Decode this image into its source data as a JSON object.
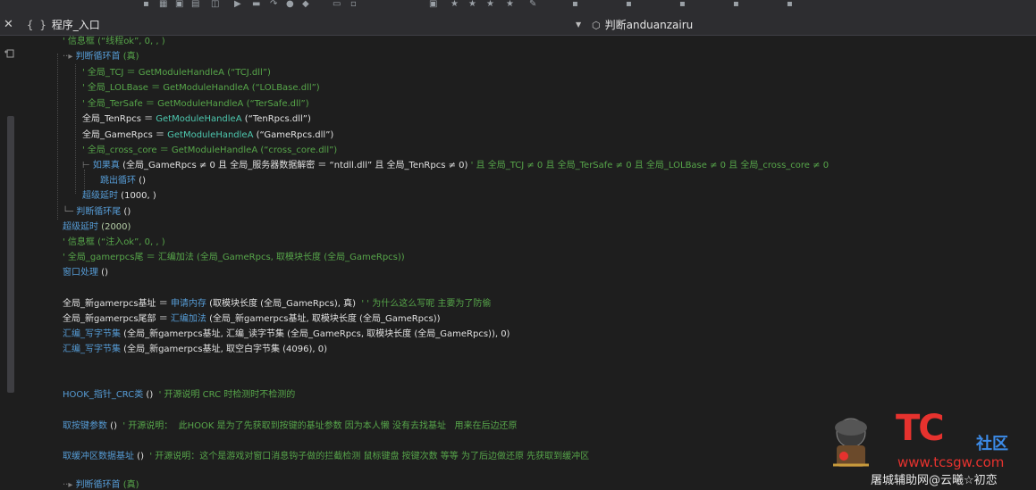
{
  "tabs": {
    "member_label": "程序_入口",
    "procedure_label": "判断anduanzairu"
  },
  "code": {
    "l1": "' 信息框 (“线程ok”, 0, , )",
    "l2a": "判断循环首",
    "l2b": " (真)",
    "l3": "' 全局_TCJ ＝ GetModuleHandleA (“TCJ.dll”)",
    "l4": "' 全局_LOLBase ＝ GetModuleHandleA (“LOLBase.dll”)",
    "l5": "' 全局_TerSafe ＝ GetModuleHandleA (“TerSafe.dll”)",
    "l6a": "全局_TenRpcs ＝ ",
    "l6b": "GetModuleHandleA",
    "l6c": " (“TenRpcs.dll”)",
    "l7a": "全局_GameRpcs ＝ ",
    "l7b": "GetModuleHandleA",
    "l7c": " (“GameRpcs.dll”)",
    "l8": "' 全局_cross_core ＝ GetModuleHandleA (“cross_core.dll”)",
    "l9a": "如果真",
    "l9b": " (全局_GameRpcs ≠ 0 且 全局_服务器数据解密 ＝ “ntdll.dll” 且 全局_TenRpcs ≠ 0)",
    "l9c": " ' 且 全局_TCJ ≠ 0 且 全局_TerSafe ≠ 0 且 全局_LOLBase ≠ 0 且 全局_cross_core ≠ 0",
    "l10a": "跳出循环",
    "l10b": " ()",
    "l11a": "超级延时",
    "l11b": " (1000, )",
    "l12a": "判断循环尾",
    "l12b": " ()",
    "l13a": "超级延时",
    "l13b": " (2000)",
    "l14": "' 信息框 (“注入ok”, 0, , )",
    "l15": "' 全局_gamerpcs尾 ＝ 汇编加法 (全局_GameRpcs, 取模块长度 (全局_GameRpcs))",
    "l16a": "窗口处理",
    "l16b": " ()",
    "l17a": "全局_新gamerpcs基址 ＝ ",
    "l17b": "申请内存",
    "l17c": " (取模块长度 (全局_GameRpcs), 真)",
    "l17d": "  ' ' 为什么这么写呢 主要为了防偷",
    "l18a": "全局_新gamerpcs尾部 ＝ ",
    "l18b": "汇编加法",
    "l18c": " (全局_新gamerpcs基址, 取模块长度 (全局_GameRpcs))",
    "l19a": "汇编_写字节集",
    "l19b": " (全局_新gamerpcs基址, 汇编_读字节集 (全局_GameRpcs, 取模块长度 (全局_GameRpcs)), 0)",
    "l20a": "汇编_写字节集",
    "l20b": " (全局_新gamerpcs基址, 取空白字节集 (4096), 0)",
    "l21a": "HOOK_指针_CRC类",
    "l21b": " ()",
    "l21c": "  ' 开源说明 CRC 时检测时不检测的",
    "l22a": "取按键参数",
    "l22b": " ()",
    "l22c": "  ' 开源说明：  此HOOK 是为了先获取到按键的基址参数 因为本人懒 没有去找基址   用来在后边还原",
    "l23a": "取缓冲区数据基址",
    "l23b": " ()",
    "l23c": "  ' 开源说明：这个是游戏对窗口消息钩子做的拦截检测 鼠标键盘 按键次数 等等 为了后边做还原 先获取到缓冲区",
    "l24a": "判断循环首",
    "l24b": " (真)"
  },
  "watermark": {
    "logo": "TC",
    "club": "社区",
    "url": "www.tcsgw.com",
    "bottom": "屠城辅助网@云曦☆初恋"
  }
}
